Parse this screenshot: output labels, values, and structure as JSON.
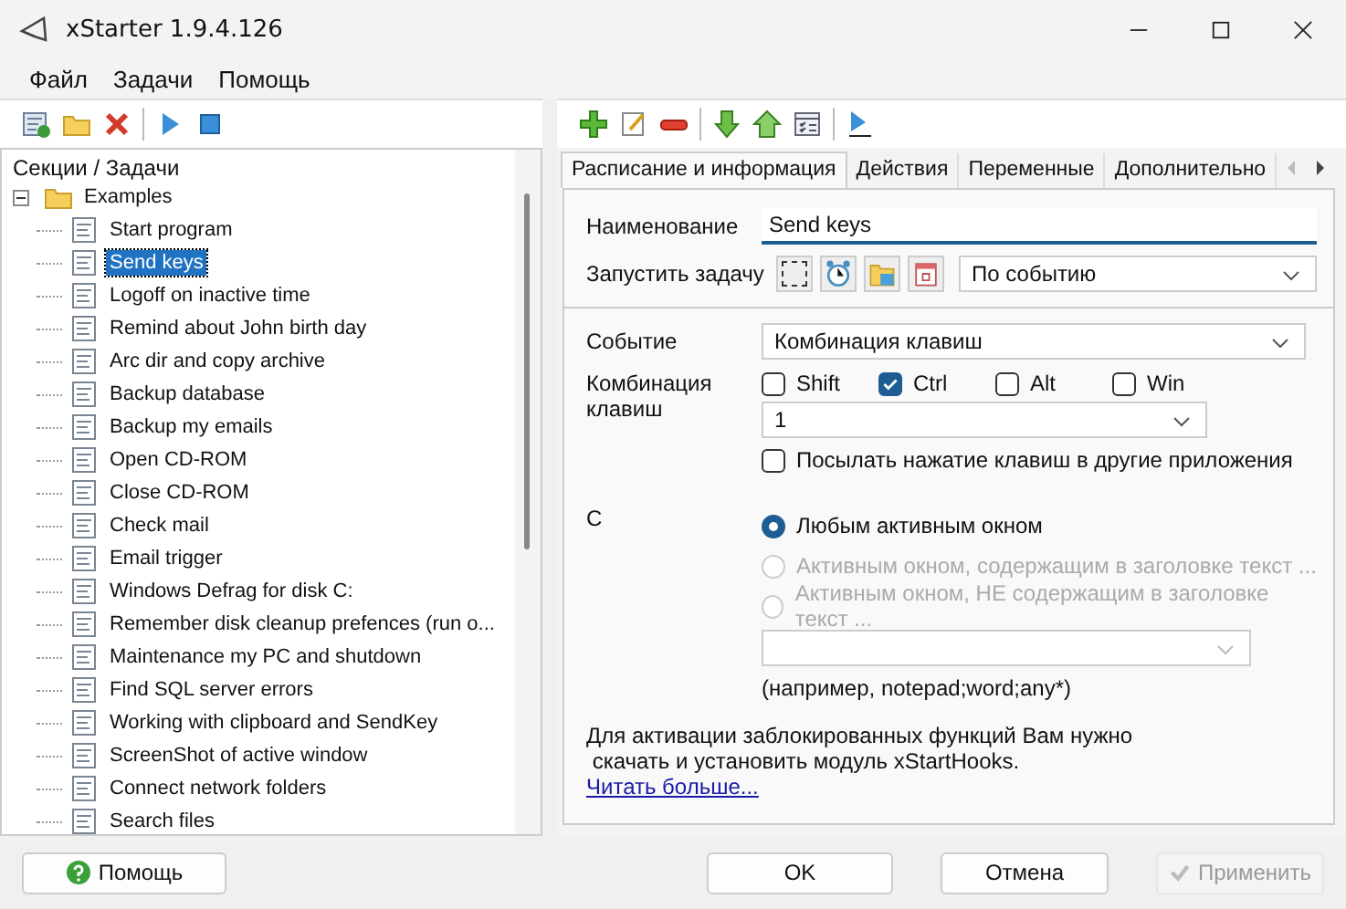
{
  "window": {
    "title": "xStarter 1.9.4.126"
  },
  "menu": [
    "Файл",
    "Задачи",
    "Помощь"
  ],
  "tree": {
    "header": "Секции / Задачи",
    "items": [
      {
        "label": "Examples",
        "expanded": true,
        "children": [
          {
            "label": "Start program",
            "selected": false
          },
          {
            "label": "Send keys",
            "selected": true
          },
          {
            "label": "Logoff on inactive time",
            "selected": false
          },
          {
            "label": "Remind about John birth day",
            "selected": false
          },
          {
            "label": "Arc dir and copy archive",
            "selected": false
          },
          {
            "label": "Backup database",
            "selected": false
          },
          {
            "label": "Backup my emails",
            "selected": false
          },
          {
            "label": "Open CD-ROM",
            "selected": false
          },
          {
            "label": "Close CD-ROM",
            "selected": false
          },
          {
            "label": "Check mail",
            "selected": false
          },
          {
            "label": "Email trigger",
            "selected": false
          },
          {
            "label": "Windows Defrag for disk C:",
            "selected": false
          },
          {
            "label": "Remember disk cleanup prefences (run o...",
            "selected": false
          },
          {
            "label": "Maintenance my PC and shutdown",
            "selected": false
          },
          {
            "label": "Find SQL server errors",
            "selected": false
          },
          {
            "label": "Working with clipboard and SendKey",
            "selected": false
          },
          {
            "label": "ScreenShot of active window",
            "selected": false
          },
          {
            "label": "Connect network folders",
            "selected": false
          },
          {
            "label": "Search files",
            "selected": false
          }
        ]
      }
    ]
  },
  "tabs": [
    {
      "label": "Расписание и информация",
      "selected": true
    },
    {
      "label": "Действия",
      "selected": false
    },
    {
      "label": "Переменные",
      "selected": false
    },
    {
      "label": "Дополнительно",
      "selected": false
    }
  ],
  "form": {
    "name_label": "Наименование",
    "name_value": "Send keys",
    "start_label": "Запустить задачу",
    "start_value": "По событию",
    "event_label": "Событие",
    "event_value": "Комбинация клавиш",
    "combo_label": "Комбинация клавиш",
    "modifiers": [
      {
        "label": "Shift",
        "checked": false
      },
      {
        "label": "Ctrl",
        "checked": true
      },
      {
        "label": "Alt",
        "checked": false
      },
      {
        "label": "Win",
        "checked": false
      }
    ],
    "key_value": "1",
    "send_option": {
      "label": "Посылать нажатие клавиш в другие приложения",
      "checked": false
    },
    "with_label": "С",
    "radios": [
      {
        "label": "Любым активным окном",
        "selected": true,
        "disabled": false
      },
      {
        "label": "Активным окном, содержащим в заголовке текст ...",
        "selected": false,
        "disabled": true
      },
      {
        "label": "Активным окном, НЕ содержащим в заголовке текст ...",
        "selected": false,
        "disabled": true
      }
    ],
    "hint": "(например, notepad;word;any*)",
    "notice_lines": [
      "Для активации заблокированных функций Вам нужно",
      " скачать и установить модуль xStartHooks."
    ],
    "link": "Читать больше..."
  },
  "buttons": [
    {
      "label": "Помощь",
      "kind": "help"
    },
    {
      "label": "OK",
      "kind": "ok"
    },
    {
      "label": "Отмена",
      "kind": "cancel"
    },
    {
      "label": "Применить",
      "kind": "apply",
      "disabled": true
    }
  ]
}
